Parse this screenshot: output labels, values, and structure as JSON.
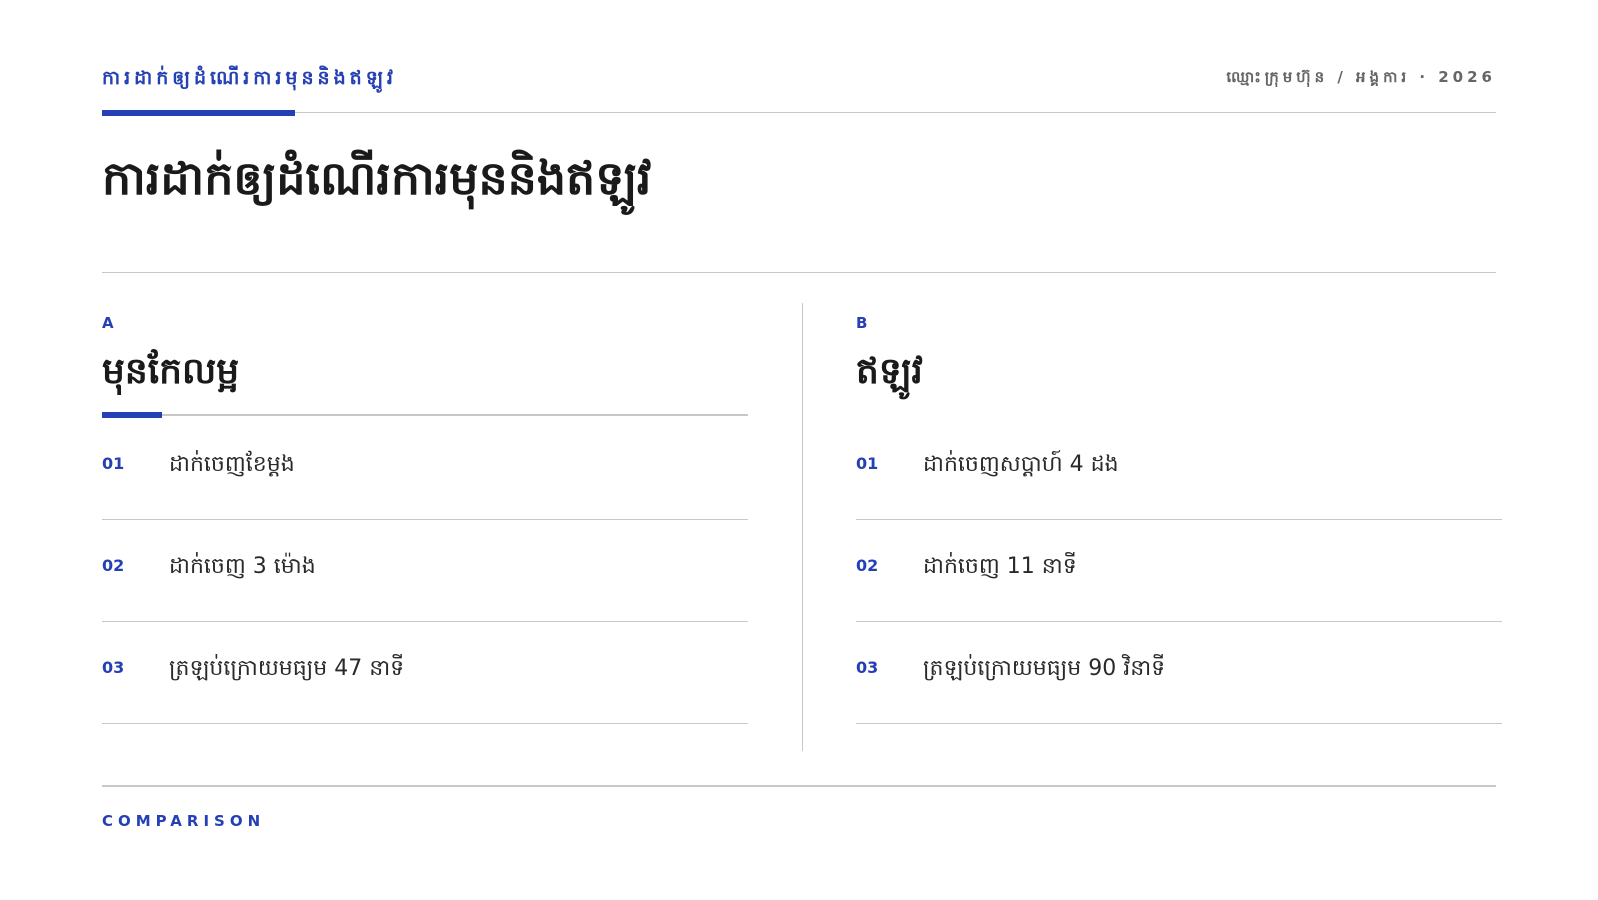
{
  "header": {
    "kicker": "ការដាក់ឲ្យដំណើរការមុននិងឥឡូវ",
    "meta": "ឈ្មោះក្រុមហ៊ុន / អង្គការ · 2026"
  },
  "title": "ការដាក់ឲ្យដំណើរការមុននិងឥឡូវ",
  "columns": [
    {
      "letter": "A",
      "heading": "មុនកែលម្អ",
      "items": [
        {
          "num": "01",
          "text": "ដាក់ចេញខែម្តង"
        },
        {
          "num": "02",
          "text": "ដាក់ចេញ 3 ម៉ោង"
        },
        {
          "num": "03",
          "text": "ត្រឡប់ក្រោយមធ្យម 47 នាទី"
        }
      ]
    },
    {
      "letter": "B",
      "heading": "ឥឡូវ",
      "items": [
        {
          "num": "01",
          "text": "ដាក់ចេញសប្តាហ៍ 4 ដង"
        },
        {
          "num": "02",
          "text": "ដាក់ចេញ 11 នាទី"
        },
        {
          "num": "03",
          "text": "ត្រឡប់ក្រោយមធ្យម 90 វិនាទី"
        }
      ]
    }
  ],
  "footer": {
    "label": "COMPARISON"
  },
  "colors": {
    "accent": "#2540b5",
    "rule": "#c8c8c8",
    "text": "#1f1f1f",
    "muted": "#666666"
  }
}
